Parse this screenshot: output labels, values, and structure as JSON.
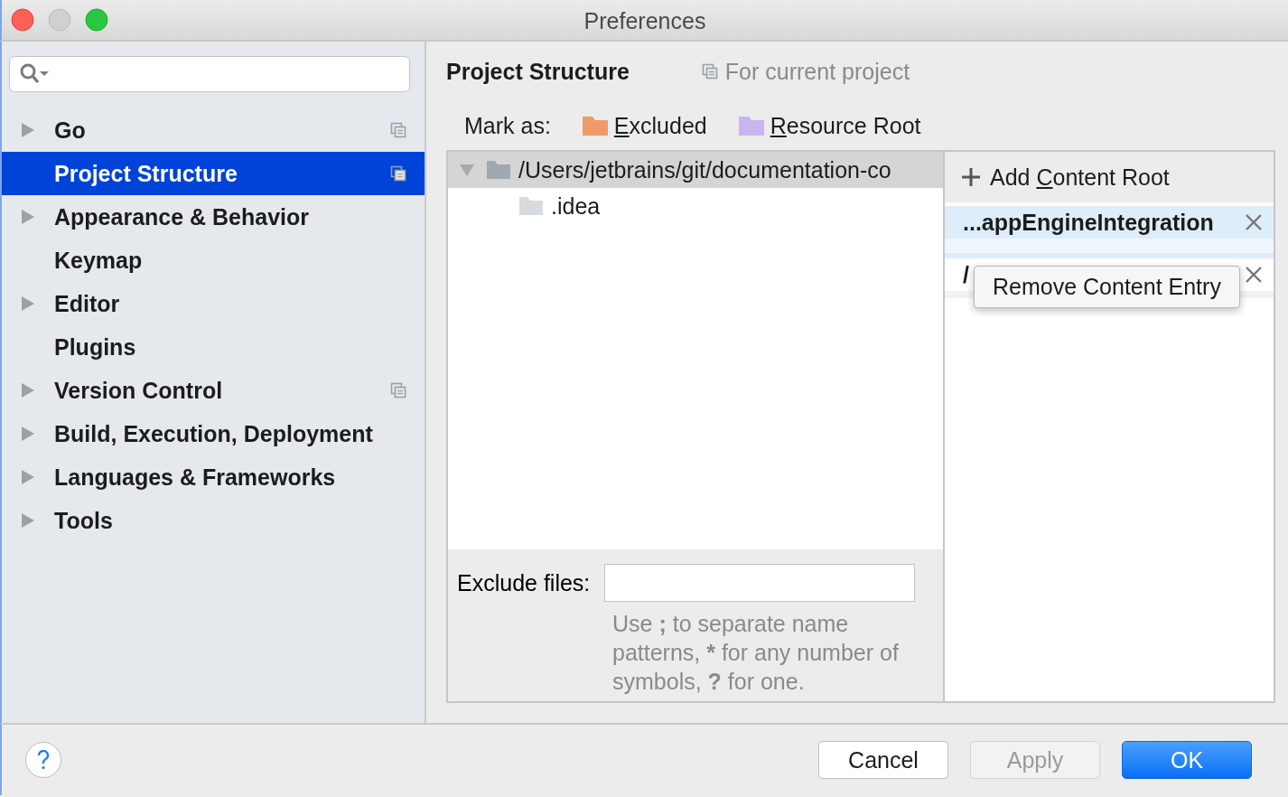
{
  "window": {
    "title": "Preferences"
  },
  "sidebar": {
    "items": [
      {
        "label": "Go",
        "expandable": true,
        "project_level": true,
        "selected": false
      },
      {
        "label": "Project Structure",
        "expandable": false,
        "project_level": true,
        "selected": true
      },
      {
        "label": "Appearance & Behavior",
        "expandable": true,
        "project_level": false,
        "selected": false
      },
      {
        "label": "Keymap",
        "expandable": false,
        "project_level": false,
        "selected": false
      },
      {
        "label": "Editor",
        "expandable": true,
        "project_level": false,
        "selected": false
      },
      {
        "label": "Plugins",
        "expandable": false,
        "project_level": false,
        "selected": false
      },
      {
        "label": "Version Control",
        "expandable": true,
        "project_level": true,
        "selected": false
      },
      {
        "label": "Build, Execution, Deployment",
        "expandable": true,
        "project_level": false,
        "selected": false
      },
      {
        "label": "Languages & Frameworks",
        "expandable": true,
        "project_level": false,
        "selected": false
      },
      {
        "label": "Tools",
        "expandable": true,
        "project_level": false,
        "selected": false
      }
    ]
  },
  "header": {
    "title": "Project Structure",
    "scope": "For current project"
  },
  "mark_as": {
    "label": "Mark as:",
    "options": [
      {
        "mnemonic": "E",
        "rest": "xcluded",
        "color": "#f09a6a"
      },
      {
        "mnemonic": "R",
        "rest": "esource Root",
        "color": "#c9b4f0"
      }
    ]
  },
  "tree": {
    "items": [
      {
        "label": "/Users/jetbrains/git/documentation-co",
        "expanded": true,
        "selected": true,
        "children": [
          {
            "label": ".idea",
            "selected": false
          }
        ]
      }
    ]
  },
  "exclude_files": {
    "label": "Exclude files:",
    "hint": "Use **;** to separate name patterns, ***** for any number of symbols, **?** for one."
  },
  "content_roots": {
    "add_label": {
      "before": "Add ",
      "mnemonic": "C",
      "rest": "ontent Root"
    },
    "entries": [
      {
        "label": "...appEngineIntegration",
        "selected": true
      },
      {
        "label": "/",
        "selected": false
      }
    ],
    "context_menu": {
      "items": [
        "Remove Content Entry"
      ]
    }
  },
  "footer": {
    "buttons": [
      {
        "label": "Cancel",
        "kind": "normal",
        "disabled": false
      },
      {
        "label": "Apply",
        "kind": "normal",
        "disabled": true
      },
      {
        "label": "OK",
        "kind": "default",
        "disabled": false
      }
    ]
  }
}
